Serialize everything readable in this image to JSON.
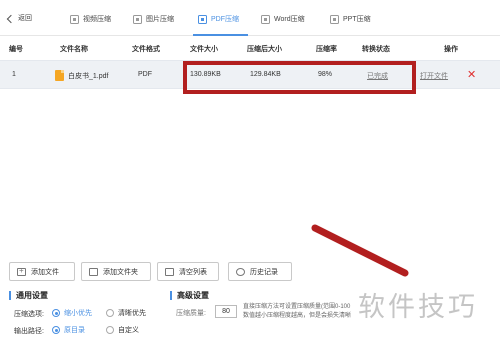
{
  "topbar": {
    "back_label": "返回",
    "tabs": [
      {
        "label": "视频压缩",
        "active": false
      },
      {
        "label": "图片压缩",
        "active": false
      },
      {
        "label": "PDF压缩",
        "active": true
      },
      {
        "label": "Word压缩",
        "active": false
      },
      {
        "label": "PPT压缩",
        "active": false
      }
    ]
  },
  "table": {
    "headers": [
      "编号",
      "文件名称",
      "文件格式",
      "文件大小",
      "压缩后大小",
      "压缩率",
      "转换状态",
      "操作"
    ],
    "rows": [
      {
        "index": "1",
        "name": "白皮书_1.pdf",
        "format": "PDF",
        "size": "130.89KB",
        "compressed_size": "129.84KB",
        "ratio": "98%",
        "status": "已完成",
        "action": "打开文件",
        "delete": "✕"
      }
    ]
  },
  "actions": {
    "add_file": "添加文件",
    "add_folder": "添加文件夹",
    "clear_list": "清空列表",
    "history": "历史记录"
  },
  "settings": {
    "general_title": "通用设置",
    "compress_option_label": "压缩选项:",
    "option_small": "缩小优先",
    "option_clear": "清晰优先",
    "output_label": "输出路径:",
    "output_original": "原目录",
    "output_custom": "自定义",
    "advanced_title": "高级设置",
    "level_label": "压缩质量:",
    "level_value": "80",
    "hint_line1": "直接压缩方法可设置压缩质量(范围0-100",
    "hint_line2": "数值越小压缩程度越高，但是会损失清晰"
  },
  "watermark": "软件技巧",
  "colors": {
    "accent": "#4a90e2",
    "highlight": "#b21f1f",
    "delete": "#e03030"
  }
}
